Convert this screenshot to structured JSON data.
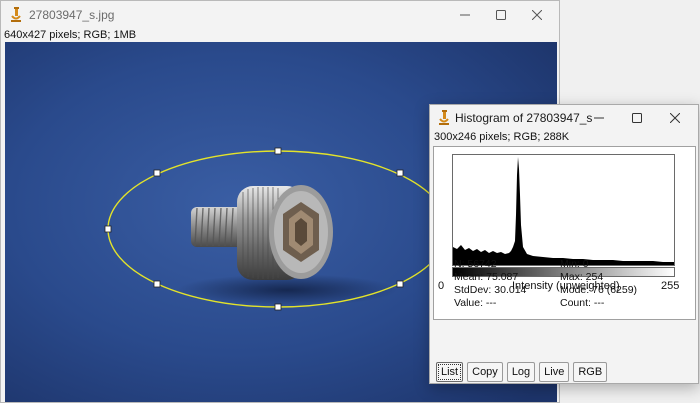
{
  "main_window": {
    "title": "27803947_s.jpg",
    "info": "640x427 pixels; RGB; 1MB"
  },
  "histogram_window": {
    "title": "Histogram of 27803947_s",
    "info": "300x246 pixels; RGB; 288K",
    "axis": {
      "min": "0",
      "label": "Intensity (unweighted)",
      "max": "255"
    },
    "stats": {
      "n": "N: 56742",
      "mean": "Mean: 75.087",
      "stddev": "StdDev: 30.014",
      "value": "Value: ---",
      "min": "Min: 0",
      "max": "Max: 254",
      "mode": "Mode: 76 (6259)",
      "count": "Count: ---"
    },
    "buttons": [
      "List",
      "Copy",
      "Log",
      "Live",
      "RGB"
    ]
  },
  "colors": {
    "background_blue": "#2a4a8c",
    "selection_yellow": "#e3e32a"
  },
  "icons": [
    "imagej-microscope-icon",
    "minimize-icon",
    "maximize-icon",
    "close-icon"
  ]
}
